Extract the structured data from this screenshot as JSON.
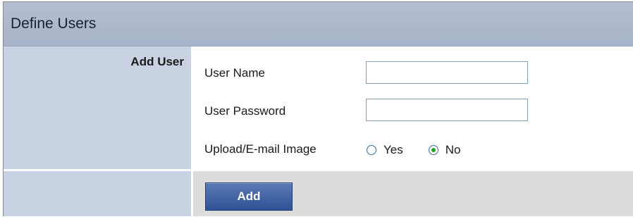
{
  "header": {
    "title": "Define Users"
  },
  "section": {
    "label": "Add User"
  },
  "form": {
    "user_name": {
      "label": "User Name",
      "value": ""
    },
    "user_password": {
      "label": "User Password",
      "value": ""
    },
    "upload_email_image": {
      "label": "Upload/E-mail Image",
      "options": [
        {
          "label": "Yes",
          "checked": false
        },
        {
          "label": "No",
          "checked": true
        }
      ]
    }
  },
  "actions": {
    "add_label": "Add"
  },
  "colors": {
    "header_bg": "#b4bfd1",
    "label_col_bg": "#c8d2e2",
    "footer_bg": "#dcdcdc",
    "button_bg": "#3f62a6",
    "radio_checked": "#21a121"
  }
}
